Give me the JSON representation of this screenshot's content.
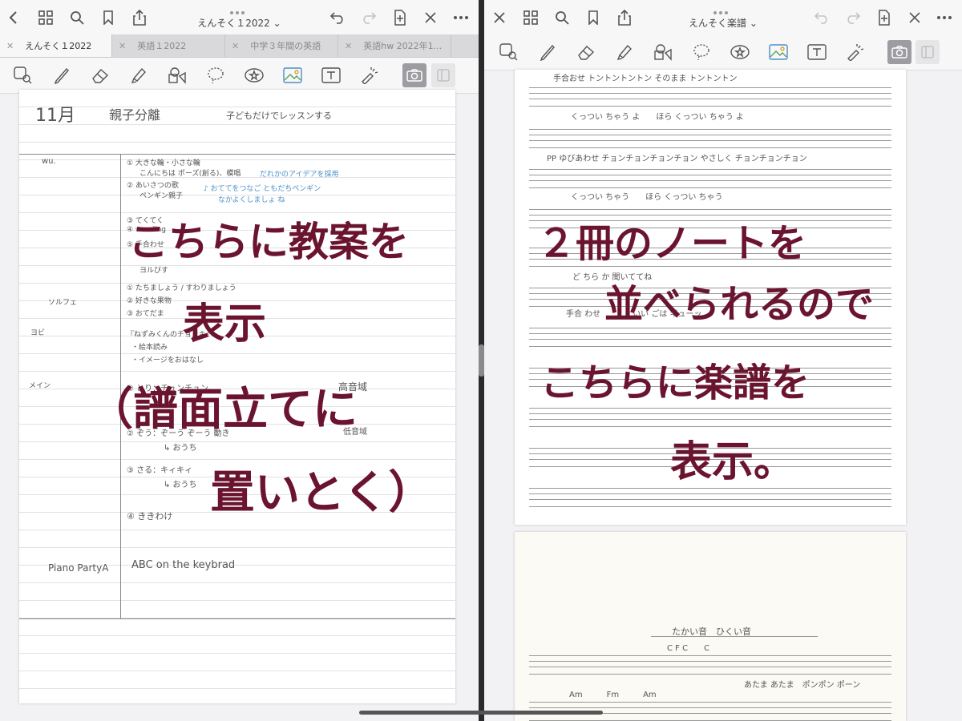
{
  "left": {
    "title": "えんそく１2022",
    "tabs": [
      {
        "label": "えんそく１2022"
      },
      {
        "label": "英語１2022"
      },
      {
        "label": "中学３年間の英語"
      },
      {
        "label": "英語hw 2022年1..."
      }
    ],
    "icons": {
      "back": "chevron-left-icon",
      "grid": "grid-icon",
      "search": "search-icon",
      "bookmark": "bookmark-icon",
      "share": "share-icon",
      "undo": "undo-icon",
      "redo": "redo-icon",
      "add_page": "add-page-icon",
      "pen_off": "pen-off-icon",
      "more": "more-icon"
    },
    "note": {
      "header_month": "11月",
      "header_topic": "親子分離",
      "header_sub": "子どもだけでレッスンする",
      "label_wu": "wu.",
      "wu_1": "① 大きな輪・小さな輪",
      "wu_1b": "こんにちは ポーズ(創る)、模唱",
      "wu_2": "② あいさつの歌",
      "wu_2b": "ペンギン親子",
      "wu_blue_1": "だれかのアイデアを採用",
      "wu_blue_2": "♪ おててをつなご ともだちペンギン",
      "wu_blue_3": "なかよくしましょ ね",
      "wu_3": "③ てくてく",
      "wu_4": "④ weeding",
      "wu_5a": "⑤ 手合わせ",
      "wu_5b": "ヨルびす",
      "label_solfege": "ソルフェ",
      "sol_1": "① たちましょう / すわりましょう",
      "sol_2": "② 好きな果物",
      "sol_3": "③ おてだま",
      "label_yobi": "ヨビ",
      "yobi_1": "『ねずみくんのチョッキ』",
      "yobi_2": "・絵本読み",
      "yobi_3": "・イメージをおはなし",
      "label_main": "メイン",
      "main_1": "① とり：チュンチュン",
      "main_1b": "高音域",
      "main_2": "② ぞう：ぞーう ぞーう 動き",
      "main_2b": "↳ おうち",
      "main_2c": "低音域",
      "main_3": "③ さる：キィキィ",
      "main_3b": "↳ おうち",
      "main_4": "④ ききわけ",
      "label_piano": "Piano PartyA",
      "piano_1": "ABC on the keybrad"
    },
    "annotation": [
      "こちらに教案を",
      "表示",
      "（譜面立てに",
      "置いとく）"
    ]
  },
  "right": {
    "title": "えんそく楽譜",
    "icons": {
      "close": "close-icon",
      "grid": "grid-icon",
      "search": "search-icon",
      "bookmark": "bookmark-icon",
      "share": "share-icon",
      "undo": "undo-icon",
      "redo": "redo-icon",
      "add_page": "add-page-icon",
      "pen_off": "pen-off-icon",
      "more": "more-icon"
    },
    "score": {
      "lyric_top": "手合おせ トントントントン そのまま トントントン",
      "lyric_1": "くっつい ちゃう よ　　ほら くっつい ちゃう よ",
      "lyric_2": "PP ゆびあわせ チョンチョンチョンチョン やさしく チョンチョンチョン",
      "lyric_3": "くっつい ちゃう　　ほら くっつい ちゃう",
      "lyric_4": "ど ちら か 聞いててね",
      "lyric_5": "手合 わせ　　　　いい ごは ギューッ",
      "page2_title": "たかい音　ひくい音",
      "page2_chords": "C F C　　C",
      "page2_lyric": "あたま あたま　ポンポン ポーン",
      "page2_chords_2": "Am　　　Fm　　　Am"
    },
    "annotation": [
      "２冊のノートを",
      "並べられるので",
      "こちらに楽譜を",
      "表示。"
    ]
  },
  "colors": {
    "ink": "#6b1430",
    "accent_blue": "#4a90c8"
  }
}
